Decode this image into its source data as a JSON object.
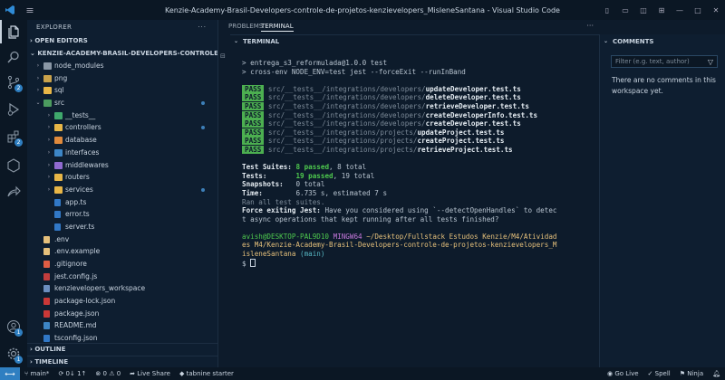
{
  "window": {
    "title": "Kenzie-Academy-Brasil-Developers-controle-de-projetos-kenzievelopers_MisleneSantana - Visual Studio Code"
  },
  "activity": {
    "search_badge": "2",
    "extensions_badge": "2",
    "account_badge": "1",
    "settings_badge": "1"
  },
  "explorer": {
    "header": "EXPLORER",
    "open_editors": "OPEN EDITORS",
    "workspace": "KENZIE-ACADEMY-BRASIL-DEVELOPERS-CONTROLE-D...",
    "items": [
      {
        "label": "node_modules"
      },
      {
        "label": "png"
      },
      {
        "label": "sql"
      },
      {
        "label": "src"
      },
      {
        "label": "__tests__"
      },
      {
        "label": "controllers"
      },
      {
        "label": "database"
      },
      {
        "label": "interfaces"
      },
      {
        "label": "middlewares"
      },
      {
        "label": "routers"
      },
      {
        "label": "services"
      },
      {
        "label": "app.ts"
      },
      {
        "label": "error.ts"
      },
      {
        "label": "server.ts"
      },
      {
        "label": ".env"
      },
      {
        "label": ".env.example"
      },
      {
        "label": ".gitignore"
      },
      {
        "label": "jest.config.js"
      },
      {
        "label": "kenzievelopers_workspace"
      },
      {
        "label": "package-lock.json"
      },
      {
        "label": "package.json"
      },
      {
        "label": "README.md"
      },
      {
        "label": "tsconfig.json"
      }
    ],
    "outline": "OUTLINE",
    "timeline": "TIMELINE"
  },
  "panel": {
    "tab_problems": "PROBLEMS",
    "tab_terminal": "TERMINAL",
    "header": "TERMINAL"
  },
  "terminal": {
    "line1": "> entrega_s3_reformulada@1.0.0 test",
    "line2": "> cross-env NODE_ENV=test jest --forceExit --runInBand",
    "pass_label": "PASS",
    "tests": [
      {
        "dir": "src/__tests__/integrations/developers/",
        "file": "updateDeveloper.test.ts"
      },
      {
        "dir": "src/__tests__/integrations/developers/",
        "file": "deleteDeveloper.test.ts"
      },
      {
        "dir": "src/__tests__/integrations/developers/",
        "file": "retrieveDeveloper.test.ts"
      },
      {
        "dir": "src/__tests__/integrations/developers/",
        "file": "createDeveloperInfo.test.ts"
      },
      {
        "dir": "src/__tests__/integrations/developers/",
        "file": "createDeveloper.test.ts"
      },
      {
        "dir": "src/__tests__/integrations/projects/",
        "file": "updateProject.test.ts"
      },
      {
        "dir": "src/__tests__/integrations/projects/",
        "file": "createProject.test.ts"
      },
      {
        "dir": "src/__tests__/integrations/projects/",
        "file": "retrieveProject.test.ts"
      }
    ],
    "suites_label": "Test Suites:",
    "suites_passed": "8 passed",
    "suites_total": ", 8 total",
    "tests_label": "Tests:",
    "tests_passed": "19 passed",
    "tests_total": ", 19 total",
    "snap_label": "Snapshots:",
    "snap_val": "0 total",
    "time_label": "Time:",
    "time_val": "6.735 s, estimated 7 s",
    "ran_all": "Ran all test suites.",
    "force_label": "Force exiting Jest:",
    "force_msg1": " Have you considered using `--detectOpenHandles` to detec",
    "force_msg2": "t async operations that kept running after all tests finished?",
    "prompt_user": "avish@DESKTOP-PAL9D10",
    "prompt_env": "MINGW64",
    "prompt_path1": "~/Desktop/Fullstack Estudos Kenzie/M4/Atividad",
    "prompt_path2": "es M4/Kenzie-Academy-Brasil-Developers-controle-de-projetos-kenzievelopers_M",
    "prompt_path3": "isleneSantana",
    "prompt_branch": "(main)",
    "prompt_symbol": "$"
  },
  "comments": {
    "header": "COMMENTS",
    "filter_placeholder": "Filter (e.g. text, author)",
    "empty": "There are no comments in this workspace yet."
  },
  "status": {
    "branch": "main*",
    "sync": "0↓ 1↑",
    "errors": "0",
    "warnings": "0",
    "live_share": "Live Share",
    "tabnine": "tabnine starter",
    "go_live": "Go Live",
    "spell": "Spell",
    "ninja": "Ninja"
  }
}
